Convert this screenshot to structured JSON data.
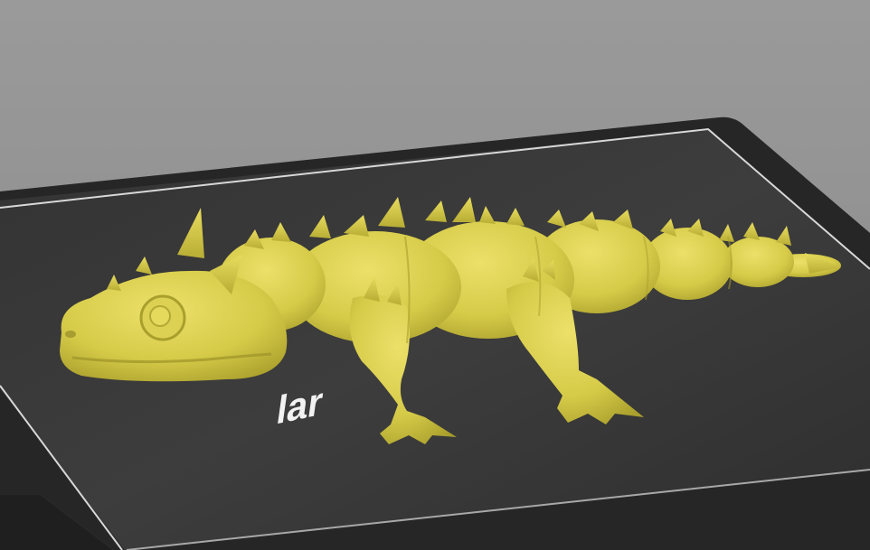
{
  "viewport": {
    "background_color": "#929292",
    "model_color": "#d9cf4e",
    "bed_surface_color": "#3a3a3a",
    "bed_frame_color": "#262626",
    "bed_border_color": "#d8d8d8"
  },
  "build_plate": {
    "logo_text_partial": "lar"
  },
  "model": {
    "description": "articulated-dragon"
  }
}
